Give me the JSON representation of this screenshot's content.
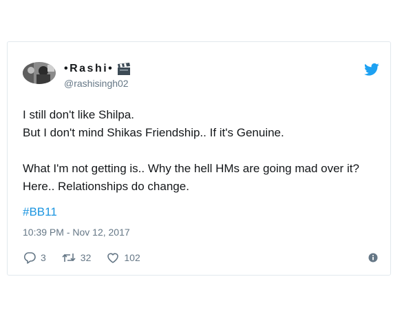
{
  "user": {
    "display_name": "•Rashi•",
    "handle": "@rashisingh02",
    "avatar_icon": "avatar-photo",
    "badge_icon": "clapperboard-icon"
  },
  "tweet": {
    "paragraph1_line1": "I still don't like Shilpa.",
    "paragraph1_line2": "But I don't mind Shikas Friendship.. If it's Genuine.",
    "paragraph2": "What I'm not getting is.. Why the hell HMs are going mad over it? Here.. Relationships do change.",
    "hashtag": "#BB11",
    "timestamp": "10:39 PM - Nov 12, 2017"
  },
  "actions": {
    "reply_count": "3",
    "retweet_count": "32",
    "like_count": "102"
  },
  "colors": {
    "twitter_blue": "#1da1f2",
    "link": "#1b95e0",
    "muted": "#657786",
    "border": "#e1e8ed"
  }
}
